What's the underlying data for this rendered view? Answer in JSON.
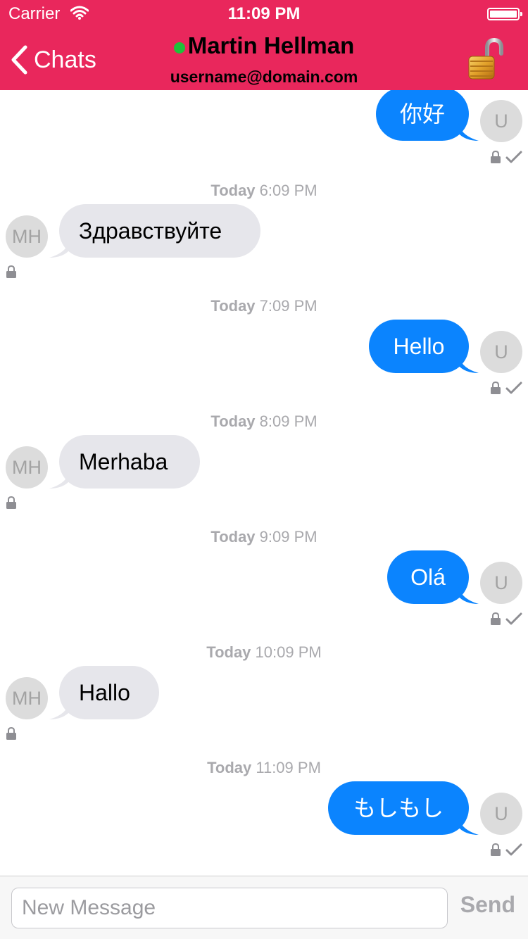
{
  "status_bar": {
    "carrier": "Carrier",
    "time": "11:09 PM"
  },
  "header": {
    "back_label": "Chats",
    "contact_name": "Martin Hellman",
    "contact_username": "username@domain.com",
    "online": true,
    "encryption_state": "unlocked",
    "colors": {
      "bar": "#e9275c",
      "online_dot": "#1ec23a"
    }
  },
  "avatars": {
    "me": "U",
    "contact": "MH"
  },
  "messages": [
    {
      "direction": "out",
      "text": "你好",
      "delivered": true
    },
    {
      "timestamp_day": "Today",
      "timestamp_time": "6:09 PM",
      "direction": "in",
      "text": "Здравствуйте"
    },
    {
      "timestamp_day": "Today",
      "timestamp_time": "7:09 PM",
      "direction": "out",
      "text": "Hello",
      "delivered": true
    },
    {
      "timestamp_day": "Today",
      "timestamp_time": "8:09 PM",
      "direction": "in",
      "text": "Merhaba"
    },
    {
      "timestamp_day": "Today",
      "timestamp_time": "9:09 PM",
      "direction": "out",
      "text": "Olá",
      "delivered": true
    },
    {
      "timestamp_day": "Today",
      "timestamp_time": "10:09 PM",
      "direction": "in",
      "text": "Hallo"
    },
    {
      "timestamp_day": "Today",
      "timestamp_time": "11:09 PM",
      "direction": "out",
      "text": "もしもし",
      "delivered": true
    }
  ],
  "composer": {
    "placeholder": "New Message",
    "send_label": "Send"
  },
  "colors": {
    "outgoing_bubble": "#0b84fe",
    "incoming_bubble": "#e6e6eb"
  }
}
